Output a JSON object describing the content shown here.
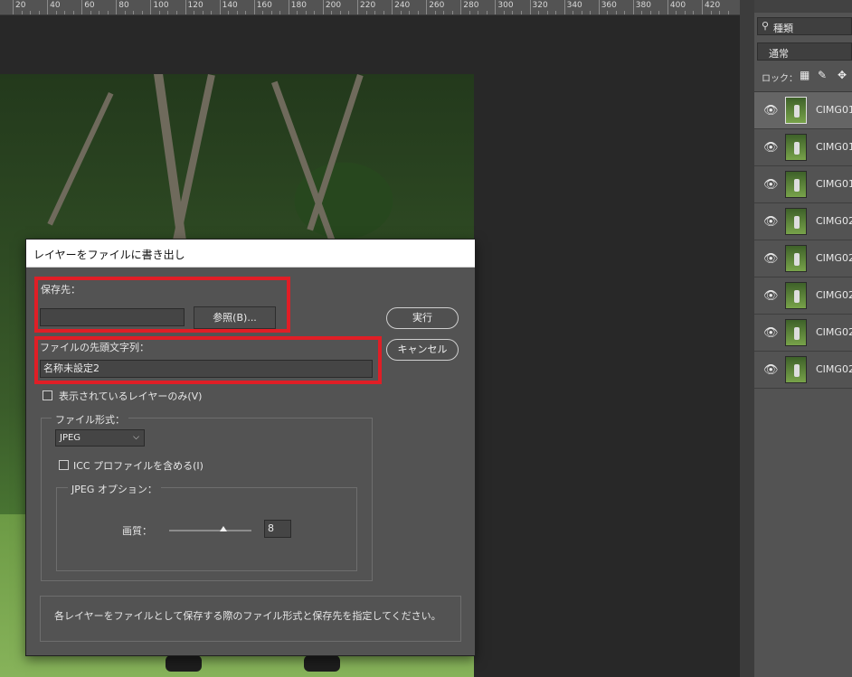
{
  "ruler": {
    "labels": [
      "20",
      "40",
      "60",
      "80",
      "100",
      "120",
      "140",
      "160",
      "180",
      "200",
      "220",
      "240",
      "260",
      "280",
      "300",
      "320",
      "340",
      "360",
      "380",
      "400",
      "420"
    ]
  },
  "layers_panel": {
    "kind_filter_icon": "search-icon",
    "kind_filter": "種類",
    "blend_mode": "通常",
    "lock_label": "ロック：",
    "lock_icons": [
      "lock-transparent-icon",
      "lock-paint-icon",
      "lock-move-icon"
    ],
    "layers": [
      {
        "name": "CIMG01",
        "selected": true
      },
      {
        "name": "CIMG01",
        "selected": false
      },
      {
        "name": "CIMG01",
        "selected": false
      },
      {
        "name": "CIMG02",
        "selected": false
      },
      {
        "name": "CIMG02",
        "selected": false
      },
      {
        "name": "CIMG02",
        "selected": false
      },
      {
        "name": "CIMG02",
        "selected": false
      },
      {
        "name": "CIMG02",
        "selected": false
      }
    ]
  },
  "dialog": {
    "title": "レイヤーをファイルに書き出し",
    "destination_label": "保存先：",
    "destination_value": "",
    "browse_button": "参照(B)...",
    "run_button": "実行",
    "cancel_button": "キャンセル",
    "prefix_label": "ファイルの先頭文字列：",
    "prefix_value": "名称未設定2",
    "visible_only_label": "表示されているレイヤーのみ(V)",
    "visible_only_checked": false,
    "file_type_legend": "ファイル形式：",
    "file_type_value": "JPEG",
    "icc_label": "ICC プロファイルを含める(I)",
    "icc_checked": false,
    "jpeg_options_legend": "JPEG オプション：",
    "quality_label": "画質：",
    "quality_value": "8",
    "description": "各レイヤーをファイルとして保存する際のファイル形式と保存先を指定してください。",
    "highlight_color": "#e01e26"
  }
}
